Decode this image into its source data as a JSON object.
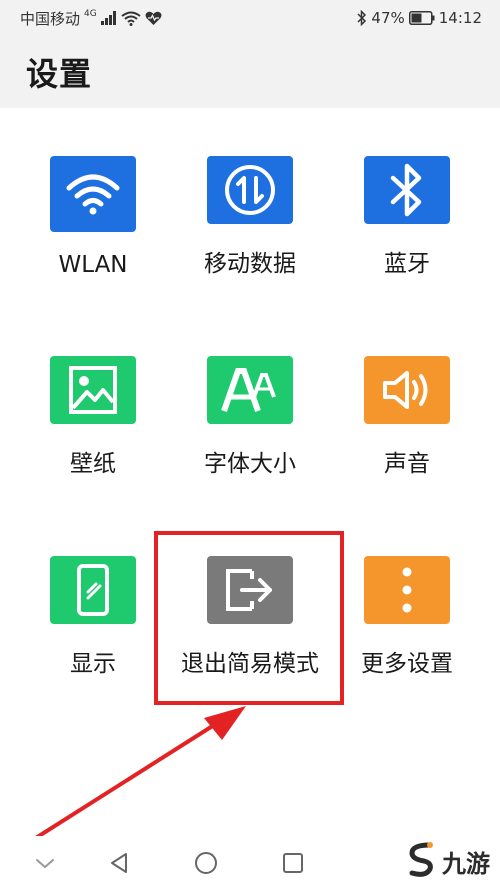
{
  "status_bar": {
    "carrier": "中国移动",
    "network_type": "4G",
    "battery_percent": "47%",
    "time": "14:12",
    "icons": [
      "signal-icon",
      "wifi-icon",
      "heart-health-icon",
      "bluetooth-icon",
      "battery-icon"
    ]
  },
  "header": {
    "title": "设置"
  },
  "tiles": [
    {
      "label": "WLAN",
      "icon": "wifi-icon",
      "color": "#1e6fe0"
    },
    {
      "label": "移动数据",
      "icon": "mobile-data-icon",
      "color": "#1e6fe0"
    },
    {
      "label": "蓝牙",
      "icon": "bluetooth-icon",
      "color": "#1e6fe0"
    },
    {
      "label": "壁纸",
      "icon": "wallpaper-image-icon",
      "color": "#1fc96e"
    },
    {
      "label": "字体大小",
      "icon": "font-size-icon",
      "color": "#1fc96e"
    },
    {
      "label": "声音",
      "icon": "speaker-icon",
      "color": "#f5962d"
    },
    {
      "label": "显示",
      "icon": "display-phone-icon",
      "color": "#1fc96e"
    },
    {
      "label": "退出简易模式",
      "icon": "exit-mode-icon",
      "color": "#7a7a7a"
    },
    {
      "label": "更多设置",
      "icon": "more-vertical-icon",
      "color": "#f5962d"
    }
  ],
  "nav_bar": {
    "icons": [
      "collapse-chevron-icon",
      "back-triangle-icon",
      "home-circle-icon",
      "recents-square-icon"
    ]
  },
  "watermark": {
    "text": "九游",
    "icon": "jiuyou-logo-icon"
  },
  "colors": {
    "highlight": "#e32323",
    "header_bg": "#f2f2f2"
  }
}
